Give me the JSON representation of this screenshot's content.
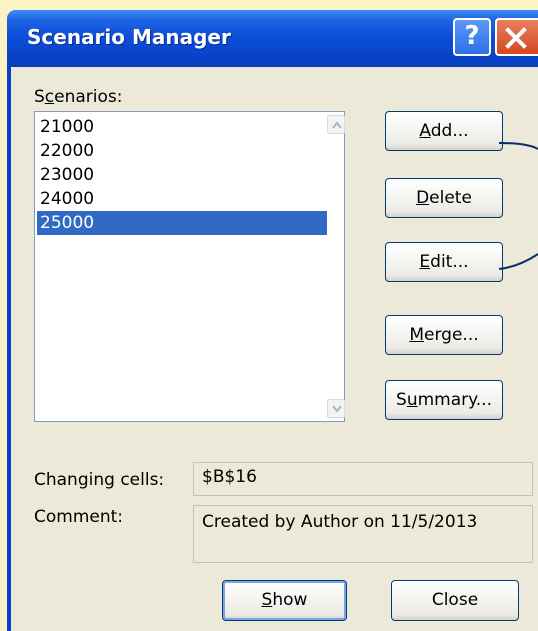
{
  "window": {
    "title": "Scenario Manager",
    "help_icon_glyph": "?"
  },
  "scenarios": {
    "label_pre": "S",
    "label_accel": "c",
    "label_post": "enarios:",
    "items": [
      "21000",
      "22000",
      "23000",
      "24000",
      "25000"
    ],
    "selected_index": 4
  },
  "buttons": {
    "add": {
      "accel": "A",
      "rest": "dd..."
    },
    "delete": {
      "accel": "D",
      "rest": "elete"
    },
    "edit": {
      "accel": "E",
      "rest": "dit..."
    },
    "merge": {
      "accel": "M",
      "rest": "erge..."
    },
    "summary": {
      "pre": "S",
      "accel": "u",
      "rest": "mmary..."
    },
    "show": {
      "accel": "S",
      "rest": "how"
    },
    "close": "Close"
  },
  "details": {
    "changing_cells_label": "Changing cells:",
    "changing_cells_value": "$B$16",
    "comment_label": "Comment:",
    "comment_value": "Created by Author on 11/5/2013"
  },
  "colors": {
    "titlebar": "#0B4CD8",
    "selection": "#316AC5",
    "background_page": "#FBF3C6",
    "dialog_face": "#ECE9D8"
  }
}
